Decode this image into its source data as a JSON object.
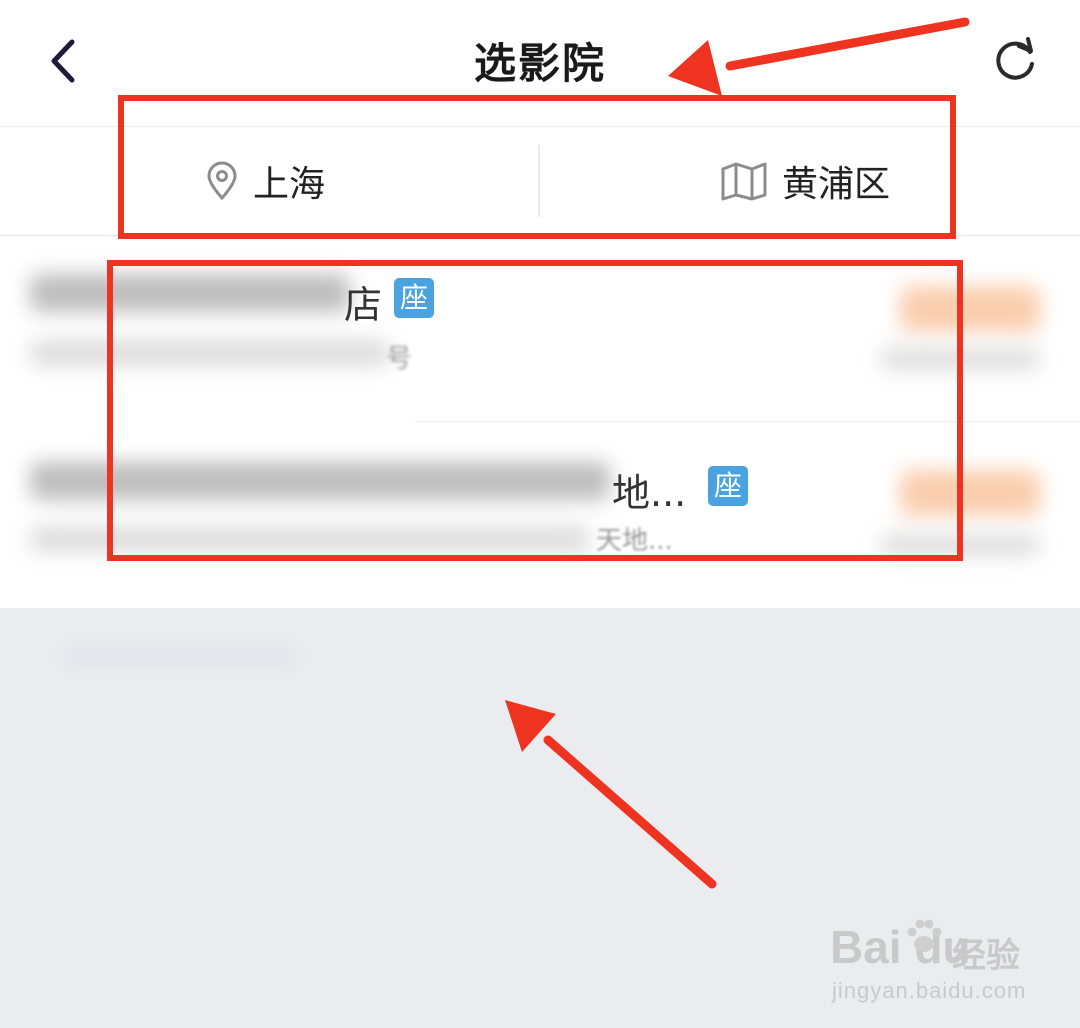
{
  "header": {
    "title": "选影院",
    "back_icon": "chevron-left-icon",
    "refresh_icon": "refresh-icon"
  },
  "filters": {
    "city": {
      "label": "上海",
      "icon": "location-pin-icon"
    },
    "district": {
      "label": "黄浦区",
      "icon": "map-icon"
    }
  },
  "cinemas": [
    {
      "name_visible": "店",
      "seat_badge": "座",
      "address_visible": "号"
    },
    {
      "name_visible": "地...",
      "seat_badge": "座",
      "address_visible": "天地..."
    }
  ],
  "watermark": {
    "brand": "Bai du",
    "suffix": "经验",
    "url": "jingyan.baidu.com"
  },
  "colors": {
    "annotation": "#ee3320",
    "seat_badge": "#4aa3df",
    "price_blur": "#f6a56a",
    "empty_background": "#ebecef"
  }
}
